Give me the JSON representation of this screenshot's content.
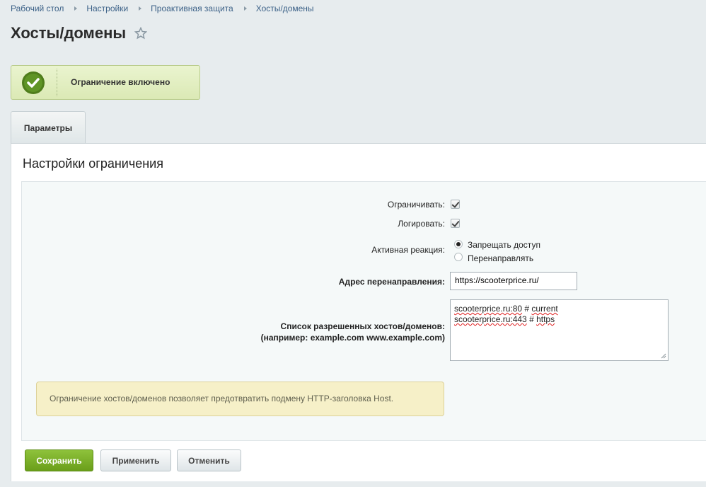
{
  "breadcrumb": [
    "Рабочий стол",
    "Настройки",
    "Проактивная защита",
    "Хосты/домены"
  ],
  "page": {
    "title": "Хосты/домены"
  },
  "status": {
    "text": "Ограничение включено",
    "color": "#5d8f22"
  },
  "tabs": [
    {
      "label": "Параметры",
      "active": true
    }
  ],
  "section": {
    "title": "Настройки ограничения"
  },
  "form": {
    "restrict": {
      "label": "Ограничивать:",
      "checked": true
    },
    "log": {
      "label": "Логировать:",
      "checked": true
    },
    "reaction": {
      "label": "Активная реакция:",
      "options": [
        {
          "label": "Запрещать доступ",
          "checked": true
        },
        {
          "label": "Перенаправлять",
          "checked": false
        }
      ]
    },
    "redirect": {
      "label": "Адрес перенаправления:",
      "value": "https://scooterprice.ru/"
    },
    "hosts": {
      "label_line1": "Список разрешенных хостов/доменов:",
      "label_line2": "(например: example.com www.example.com)",
      "lines": [
        {
          "host": "scooterprice.ru:80",
          "comment": "current"
        },
        {
          "host": "scooterprice.ru:443",
          "comment": "https"
        }
      ]
    }
  },
  "note": "Ограничение хостов/доменов позволяет предотвратить подмену HTTP-заголовка Host.",
  "buttons": {
    "save": "Сохранить",
    "apply": "Применить",
    "cancel": "Отменить"
  },
  "colors": {
    "accent_green": "#77ab22",
    "link": "#3d6288",
    "note_bg": "#f6f0c8"
  }
}
